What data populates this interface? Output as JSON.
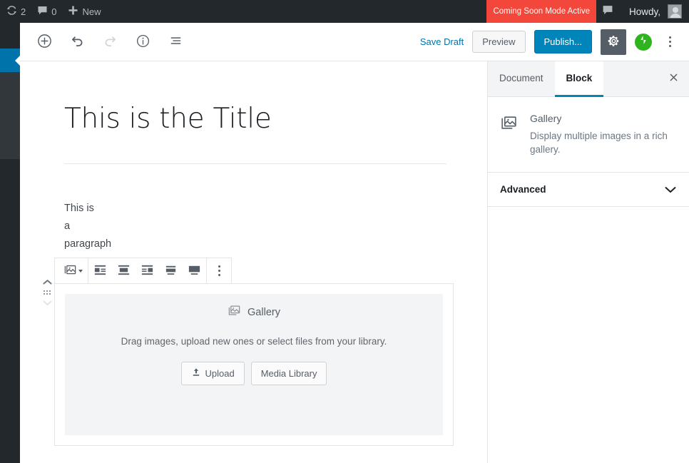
{
  "adminbar": {
    "revisions": {
      "icon": "update-icon",
      "count": "2"
    },
    "comments": {
      "icon": "comment-icon",
      "count": "0"
    },
    "new": {
      "icon": "plus-icon",
      "label": "New"
    },
    "coming_soon": "Coming Soon Mode Active",
    "notice_icon": "comment-bubble-icon",
    "howdy": "Howdy,",
    "avatar": "avatar"
  },
  "editor_header": {
    "tools": [
      {
        "name": "add-block-button",
        "icon": "plus-circle-icon"
      },
      {
        "name": "undo-button",
        "icon": "undo-icon"
      },
      {
        "name": "redo-button",
        "icon": "redo-icon"
      },
      {
        "name": "content-info-button",
        "icon": "info-circle-icon"
      },
      {
        "name": "block-navigation-button",
        "icon": "list-view-icon"
      }
    ],
    "save_draft": "Save Draft",
    "preview": "Preview",
    "publish": "Publish...",
    "settings_icon": "gear-icon",
    "jetpack_icon": "jetpack-icon",
    "more_menu_icon": "kebab-menu-icon"
  },
  "content": {
    "title": "This is the Title",
    "paragraph_lines": [
      "This is",
      "a",
      "paragraph"
    ],
    "mover": {
      "up_icon": "chevron-up-icon",
      "drag_icon": "drag-handle-icon",
      "down_icon": "chevron-down-icon"
    }
  },
  "block_toolbar": {
    "block_type": {
      "name": "gallery-block-type",
      "icon": "gallery-icon"
    },
    "alignments": [
      {
        "name": "align-left-button",
        "icon": "align-left-icon"
      },
      {
        "name": "align-center-button",
        "icon": "align-center-icon"
      },
      {
        "name": "align-right-button",
        "icon": "align-right-icon"
      },
      {
        "name": "wide-width-button",
        "icon": "wide-width-icon"
      },
      {
        "name": "full-width-button",
        "icon": "full-width-icon"
      }
    ],
    "more_icon": "kebab-menu-icon"
  },
  "gallery_placeholder": {
    "icon": "gallery-icon",
    "label": "Gallery",
    "instructions": "Drag images, upload new ones or select files from your library.",
    "upload_label": "Upload",
    "upload_icon": "upload-icon",
    "media_library_label": "Media Library"
  },
  "sidebar": {
    "tabs": [
      {
        "label": "Document",
        "active": false
      },
      {
        "label": "Block",
        "active": true
      }
    ],
    "close_icon": "close-icon",
    "block_card": {
      "icon": "gallery-icon",
      "title": "Gallery",
      "description": "Display multiple images in a rich gallery."
    },
    "panels": [
      {
        "title": "Advanced",
        "chevron": "chevron-down-icon"
      }
    ]
  },
  "colors": {
    "admin_bar": "#23282d",
    "admin_menu_active": "#0073aa",
    "coming_soon_badge": "#f4473b",
    "publish_blue": "#0085ba",
    "jetpack_green": "#2fb41f",
    "tab_underline": "#0085ba"
  }
}
